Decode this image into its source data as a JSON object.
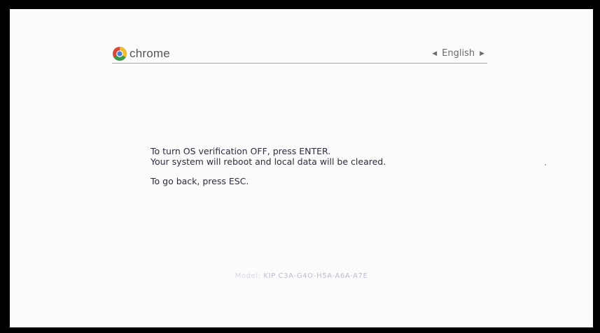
{
  "header": {
    "brand": "chrome",
    "language": {
      "label": "English",
      "prev_glyph": "◀",
      "next_glyph": "▶"
    }
  },
  "message": {
    "line1": "To turn OS verification OFF, press ENTER.",
    "line2": "Your system will reboot and local data will be cleared.",
    "line3": "To go back, press ESC."
  },
  "footer": {
    "model_prefix": "Model:",
    "model_code": "KIP C3A-G4O-H5A-A6A-A7E"
  },
  "icons": {
    "logo": "chrome-logo-icon",
    "prev": "triangle-left-icon",
    "next": "triangle-right-icon"
  },
  "colors": {
    "frame": "#000000",
    "screen_bg": "#fbfbfb",
    "text": "#2c2c3c",
    "model_text": "#b9bcd6"
  }
}
